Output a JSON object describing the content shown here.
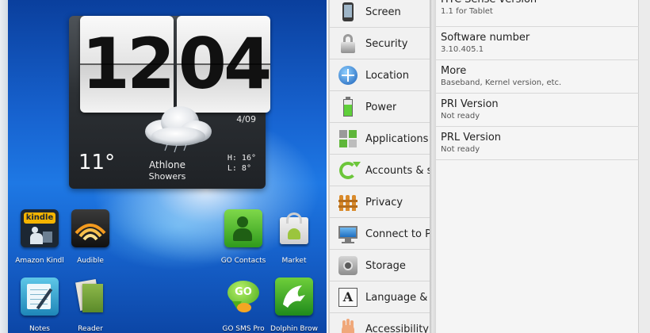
{
  "home": {
    "clock": {
      "hours": "12",
      "minutes": "04",
      "date": "4/09"
    },
    "weather": {
      "temp": "11°",
      "location": "Athlone",
      "condition": "Showers",
      "high": "H: 16°",
      "low": "L:  8°"
    },
    "apps": [
      {
        "label": "Amazon Kindl",
        "icon": "kindle-icon",
        "glyph": "kindle"
      },
      {
        "label": "Audible",
        "icon": "audible-icon"
      },
      {
        "label": "GO Contacts",
        "icon": "contacts-icon"
      },
      {
        "label": "Market",
        "icon": "market-icon"
      },
      {
        "label": "Notes",
        "icon": "notes-icon"
      },
      {
        "label": "Reader",
        "icon": "reader-icon"
      },
      {
        "label": "GO SMS Pro",
        "icon": "sms-icon",
        "glyph": "GO"
      },
      {
        "label": "Dolphin Brow",
        "icon": "dolphin-icon"
      }
    ]
  },
  "settings": {
    "items": [
      {
        "label": "Screen",
        "icon": "screen-icon"
      },
      {
        "label": "Security",
        "icon": "lock-icon"
      },
      {
        "label": "Location",
        "icon": "location-icon"
      },
      {
        "label": "Power",
        "icon": "battery-icon"
      },
      {
        "label": "Applications",
        "icon": "applications-icon"
      },
      {
        "label": "Accounts & s",
        "icon": "sync-icon"
      },
      {
        "label": "Privacy",
        "icon": "fence-icon"
      },
      {
        "label": "Connect to P",
        "icon": "pc-icon"
      },
      {
        "label": "Storage",
        "icon": "storage-icon"
      },
      {
        "label": "Language & i",
        "icon": "language-icon",
        "glyph": "A"
      },
      {
        "label": "Accessibility",
        "icon": "hand-icon"
      }
    ]
  },
  "about": {
    "rows": [
      {
        "title": "HTC Sense version",
        "sub": "1.1 for Tablet"
      },
      {
        "title": "Software number",
        "sub": "3.10.405.1"
      },
      {
        "title": "More",
        "sub": "Baseband, Kernel version, etc."
      },
      {
        "title": "PRI Version",
        "sub": "Not ready"
      },
      {
        "title": "PRL Version",
        "sub": "Not ready"
      }
    ]
  },
  "colors": {
    "wallpaper": "#1763d0",
    "settings_bg": "#f1f1f1"
  }
}
